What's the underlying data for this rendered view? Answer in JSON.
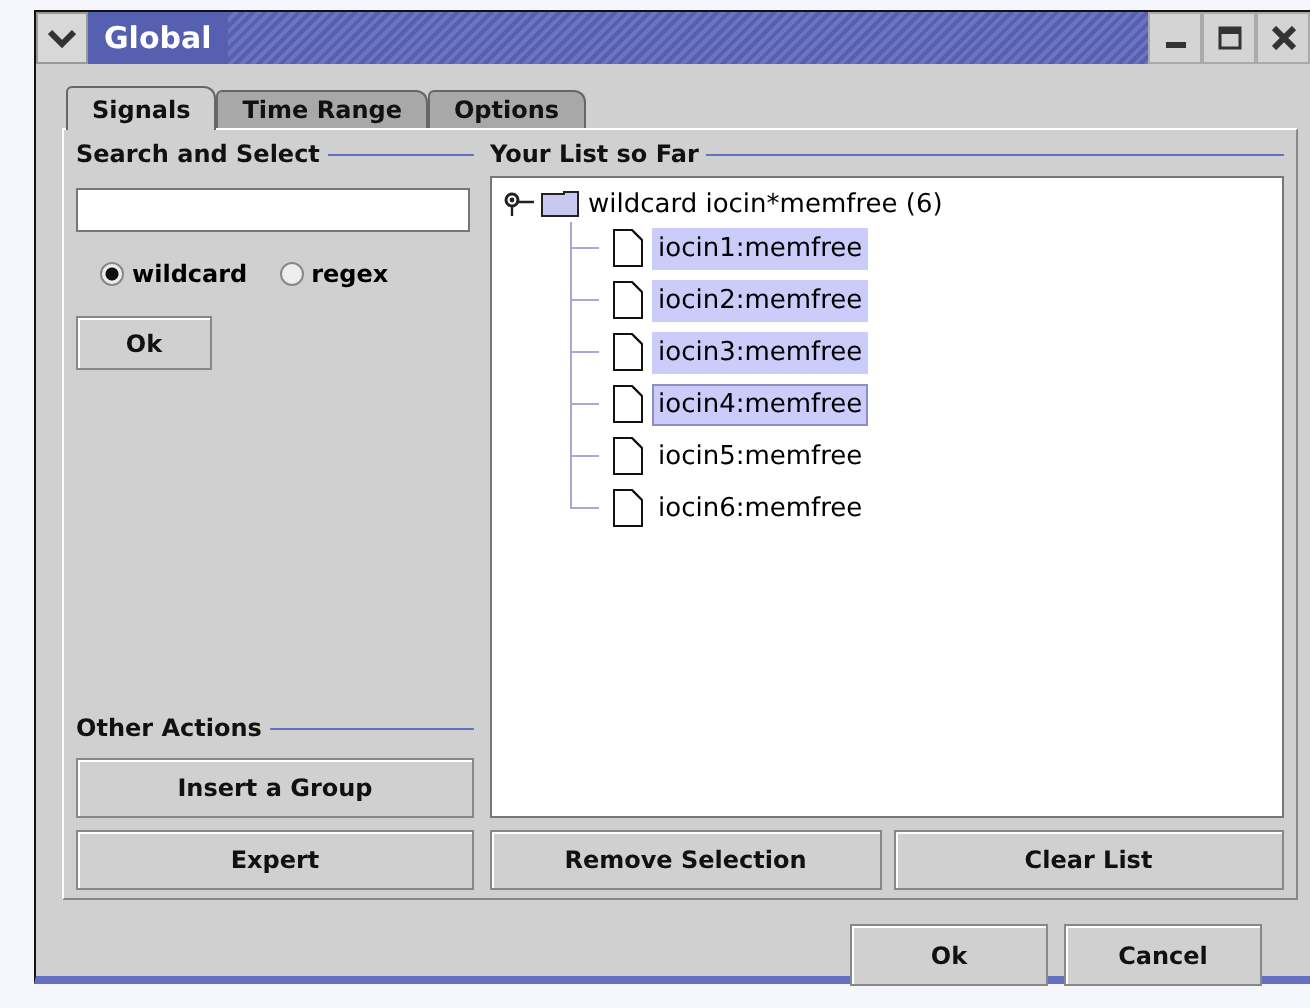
{
  "window": {
    "title": "Global"
  },
  "tabs": [
    {
      "label": "Signals",
      "selected": true
    },
    {
      "label": "Time Range",
      "selected": false
    },
    {
      "label": "Options",
      "selected": false
    }
  ],
  "search_panel": {
    "title": "Search and Select",
    "modes": [
      {
        "label": "wildcard",
        "selected": true
      },
      {
        "label": "regex",
        "selected": false
      }
    ],
    "ok_button": "Ok"
  },
  "other_actions": {
    "title": "Other Actions",
    "buttons": [
      "Insert a Group",
      "Expert"
    ]
  },
  "list_panel": {
    "title": "Your List so Far",
    "tree": {
      "label": "wildcard iocin*memfree (6)",
      "expanded": true,
      "children": [
        {
          "label": "iocin1:memfree",
          "selected": true,
          "focused": false
        },
        {
          "label": "iocin2:memfree",
          "selected": true,
          "focused": false
        },
        {
          "label": "iocin3:memfree",
          "selected": true,
          "focused": false
        },
        {
          "label": "iocin4:memfree",
          "selected": true,
          "focused": true
        },
        {
          "label": "iocin5:memfree",
          "selected": false,
          "focused": false
        },
        {
          "label": "iocin6:memfree",
          "selected": false,
          "focused": false
        }
      ]
    },
    "buttons": [
      "Remove Selection",
      "Clear List"
    ]
  },
  "dialog_buttons": [
    "Ok",
    "Cancel"
  ]
}
